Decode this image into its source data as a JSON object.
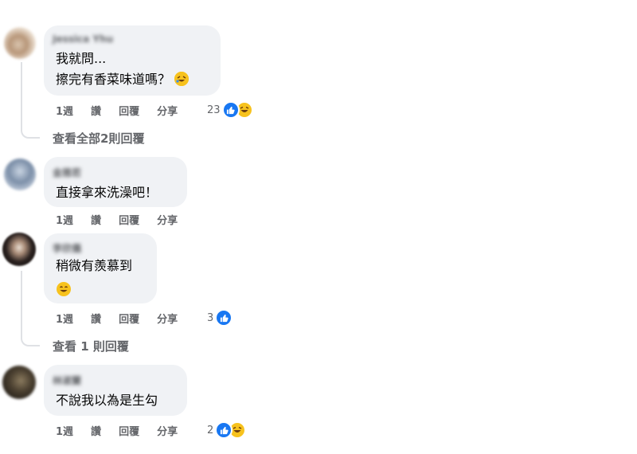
{
  "comments": [
    {
      "author": "Jessica Yhu",
      "lines": [
        "我就問...",
        "擦完有香菜味道嗎？"
      ],
      "line_emoji": "rofl-emoji",
      "time": "1週",
      "like_label": "讚",
      "reply_label": "回覆",
      "share_label": "分享",
      "reaction_count": "23",
      "reactions": [
        "like",
        "haha"
      ],
      "view_replies": "查看全部2則回覆"
    },
    {
      "author": "金雅若",
      "lines": [
        "直接拿來洗澡吧！"
      ],
      "time": "1週",
      "like_label": "讚",
      "reply_label": "回覆",
      "share_label": "分享"
    },
    {
      "author": "李欣儀",
      "lines": [
        "稍微有羨慕到"
      ],
      "line2_emoji": "grin-emoji",
      "time": "1週",
      "like_label": "讚",
      "reply_label": "回覆",
      "share_label": "分享",
      "reaction_count": "3",
      "reactions": [
        "like"
      ],
      "view_replies": "查看 1 則回覆"
    },
    {
      "author": "林淑蘭",
      "lines": [
        "不說我以為是生勾"
      ],
      "time": "1週",
      "like_label": "讚",
      "reply_label": "回覆",
      "share_label": "分享",
      "reaction_count": "2",
      "reactions": [
        "like",
        "haha"
      ]
    }
  ],
  "colors": {
    "bubble": "#f0f2f5",
    "meta_text": "#65676b",
    "like_blue": "#1877f2",
    "haha_yellow": "#f7c21d",
    "thread_line": "#dfe1e5"
  }
}
